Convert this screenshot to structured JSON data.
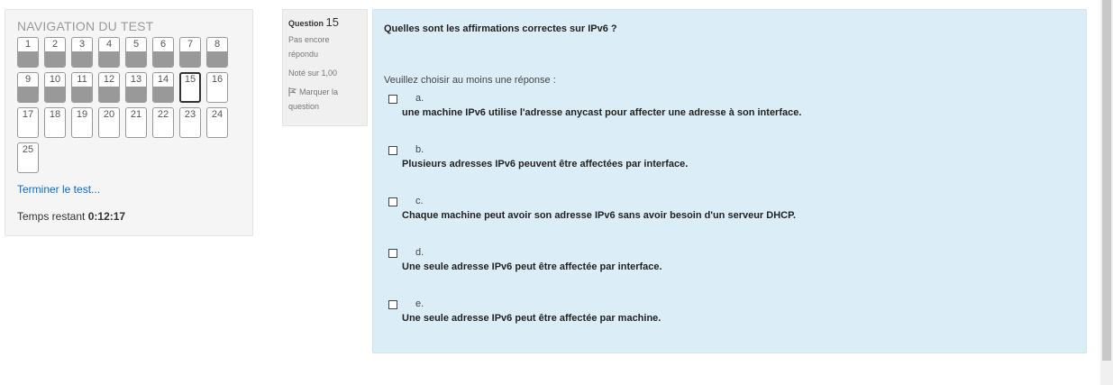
{
  "nav": {
    "title": "NAVIGATION DU TEST",
    "buttons": [
      {
        "n": "1",
        "state": "answered"
      },
      {
        "n": "2",
        "state": "answered"
      },
      {
        "n": "3",
        "state": "answered"
      },
      {
        "n": "4",
        "state": "answered"
      },
      {
        "n": "5",
        "state": "answered"
      },
      {
        "n": "6",
        "state": "answered"
      },
      {
        "n": "7",
        "state": "answered"
      },
      {
        "n": "8",
        "state": "answered"
      },
      {
        "n": "9",
        "state": "answered"
      },
      {
        "n": "10",
        "state": "answered"
      },
      {
        "n": "11",
        "state": "answered"
      },
      {
        "n": "12",
        "state": "answered"
      },
      {
        "n": "13",
        "state": "answered"
      },
      {
        "n": "14",
        "state": "answered"
      },
      {
        "n": "15",
        "state": "current"
      },
      {
        "n": "16",
        "state": "empty"
      },
      {
        "n": "17",
        "state": "empty"
      },
      {
        "n": "18",
        "state": "empty"
      },
      {
        "n": "19",
        "state": "empty"
      },
      {
        "n": "20",
        "state": "empty"
      },
      {
        "n": "21",
        "state": "empty"
      },
      {
        "n": "22",
        "state": "empty"
      },
      {
        "n": "23",
        "state": "empty"
      },
      {
        "n": "24",
        "state": "empty"
      },
      {
        "n": "25",
        "state": "empty"
      }
    ],
    "finish_link": "Terminer le test...",
    "timer_label": "Temps restant",
    "timer_value": "0:12:17"
  },
  "info": {
    "question_label": "Question",
    "question_number": "15",
    "state": "Pas encore répondu",
    "grade": "Noté sur 1,00",
    "flag_label": "Marquer la question"
  },
  "question": {
    "text": "Quelles sont les affirmations correctes sur IPv6 ?",
    "prompt": "Veuillez choisir au moins une réponse :",
    "answers": [
      {
        "letter": "a.",
        "text": "une machine IPv6 utilise l'adresse anycast pour affecter une adresse à son interface."
      },
      {
        "letter": "b.",
        "text": "Plusieurs adresses IPv6 peuvent être affectées par interface."
      },
      {
        "letter": "c.",
        "text": "Chaque machine peut avoir son adresse IPv6 sans avoir besoin d'un serveur DHCP."
      },
      {
        "letter": "d.",
        "text": "Une seule adresse IPv6 peut être affectée par interface."
      },
      {
        "letter": "e.",
        "text": "Une seule adresse IPv6 peut être affectée par machine."
      }
    ]
  }
}
